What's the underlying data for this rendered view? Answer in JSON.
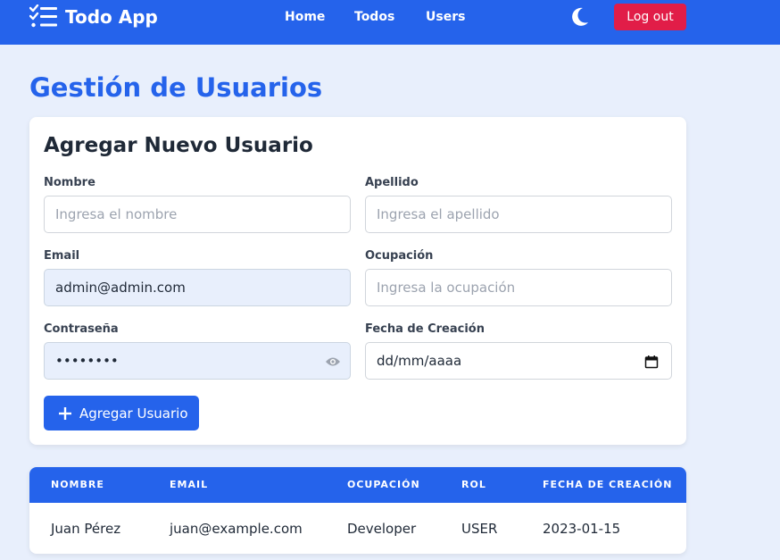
{
  "app": {
    "title": "Todo App"
  },
  "nav": {
    "home": "Home",
    "todos": "Todos",
    "users": "Users",
    "logout": "Log out"
  },
  "page": {
    "title": "Gestión de Usuarios"
  },
  "form": {
    "title": "Agregar Nuevo Usuario",
    "nombre": {
      "label": "Nombre",
      "placeholder": "Ingresa el nombre",
      "value": ""
    },
    "apellido": {
      "label": "Apellido",
      "placeholder": "Ingresa el apellido",
      "value": ""
    },
    "email": {
      "label": "Email",
      "placeholder": "",
      "value": "admin@admin.com"
    },
    "ocupacion": {
      "label": "Ocupación",
      "placeholder": "Ingresa la ocupación",
      "value": ""
    },
    "password": {
      "label": "Contraseña",
      "value": "••••••••"
    },
    "fecha": {
      "label": "Fecha de Creación",
      "value": "dd/mm/aaaa"
    },
    "submit_label": "Agregar Usuario"
  },
  "table": {
    "columns": [
      "NOMBRE",
      "EMAIL",
      "OCUPACIÓN",
      "ROL",
      "FECHA DE CREACIÓN"
    ],
    "rows": [
      [
        "Juan Pérez",
        "juan@example.com",
        "Developer",
        "USER",
        "2023-01-15"
      ]
    ]
  },
  "colors": {
    "primary": "#2563eb",
    "danger": "#e11d48",
    "background": "#e8effc"
  },
  "icons": {
    "logo": "checklist-icon",
    "theme": "moon-icon",
    "password_toggle": "eye-icon",
    "date": "calendar-icon",
    "add": "plus-icon"
  }
}
